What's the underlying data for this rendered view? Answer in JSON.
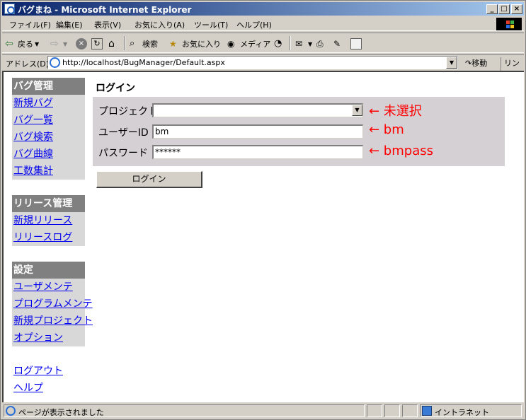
{
  "window": {
    "title": "バグまね - Microsoft Internet Explorer",
    "min_label": "_",
    "max_label": "□",
    "close_label": "×"
  },
  "menu": [
    {
      "label": "ファイル(F)"
    },
    {
      "label": "編集(E)"
    },
    {
      "label": "表示(V)"
    },
    {
      "label": "お気に入り(A)"
    },
    {
      "label": "ツール(T)"
    },
    {
      "label": "ヘルプ(H)"
    }
  ],
  "toolbar": {
    "back": "戻る",
    "search": "検索",
    "favorites": "お気に入り",
    "media": "メディア"
  },
  "address": {
    "label": "アドレス(D)",
    "url": "http://localhost/BugManager/Default.aspx",
    "go": "移動",
    "links": "リンク"
  },
  "nav": {
    "bug": {
      "header": "バグ管理",
      "items": [
        "新規バグ",
        "バグ一覧",
        "バグ検索",
        "バグ曲線",
        "工数集計"
      ]
    },
    "release": {
      "header": "リリース管理",
      "items": [
        "新規リリース",
        "リリースログ"
      ]
    },
    "settings": {
      "header": "設定",
      "items": [
        "ユーザメンテ",
        "プログラムメンテ",
        "新規プロジェクト",
        "オプション"
      ]
    },
    "logout": "ログアウト",
    "help": "ヘルプ"
  },
  "login": {
    "title": "ログイン",
    "project_label": "プロジェクト",
    "project_value": "",
    "userid_label": "ユーザーID",
    "userid_value": "bm",
    "password_label": "パスワード",
    "password_value": "******",
    "button": "ログイン"
  },
  "annotations": {
    "project": "← 未選択",
    "userid": "← bm",
    "password": "← bmpass"
  },
  "status": {
    "text": "ページが表示されました",
    "zone": "イントラネット"
  },
  "colors": {
    "annotation": "#ff0000",
    "nav_header": "#808080",
    "link": "#0000ee"
  }
}
